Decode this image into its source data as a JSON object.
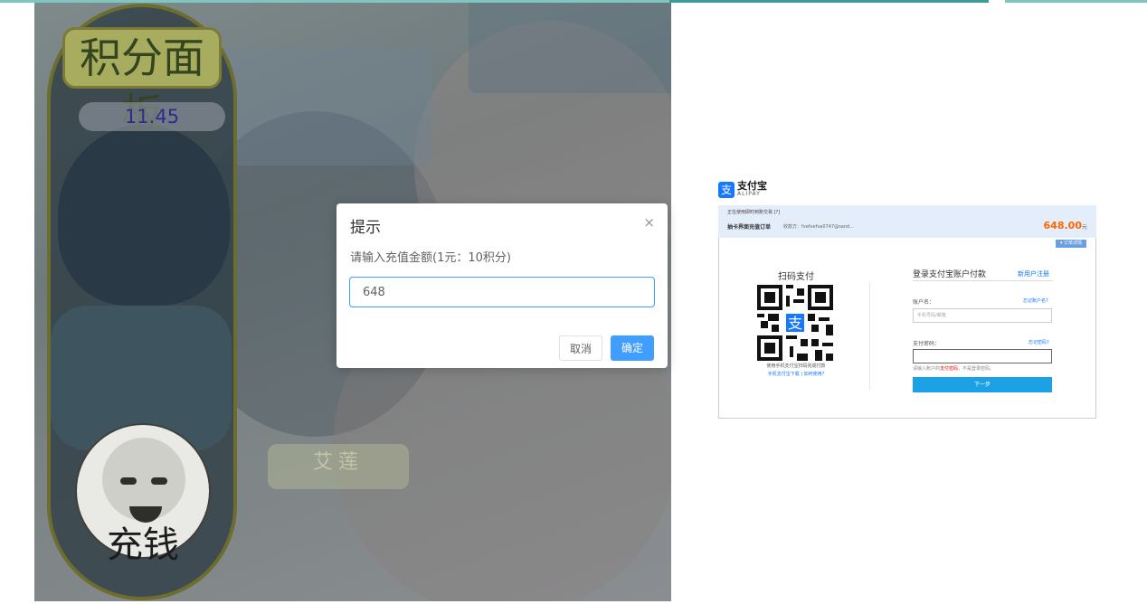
{
  "game": {
    "title": "积分面板",
    "score": "11.45",
    "charge_label": "充钱",
    "ghost_text": "艾莲"
  },
  "dialog": {
    "title": "提示",
    "close": "×",
    "message": "请输入充值金额(1元：10积分)",
    "input_value": "648",
    "cancel_label": "取消",
    "ok_label": "确定"
  },
  "alipay": {
    "logo_glyph": "支",
    "brand": "支付宝",
    "brand_sub": "ALIPAY",
    "order_line1": "正在使用即时到账交易 [?]",
    "order_name": "抽卡界面充值订单",
    "seller": "收款方：fvefvefva0747@sand...",
    "amount": "648.00",
    "amount_unit": "元",
    "detail_btn": "▾ 订单详情",
    "scan_title": "扫码支付",
    "scan_hint": "使用手机支付宝扫码完成付款",
    "scan_links": "手机支付宝下载 | 如何使用?",
    "login_title": "登录支付宝账户付款",
    "register_link": "新用户注册",
    "account_label": "账户名：",
    "forgot_account": "忘记账户名?",
    "account_placeholder": "手机号码/邮箱",
    "password_label": "支付密码：",
    "forgot_password": "忘记密码?",
    "warn_prefix": "请输入账户的",
    "warn_highlight": "支付密码",
    "warn_suffix": "，不是登录密码。",
    "next_label": "下一步"
  },
  "colors": {
    "primary": "#409eff",
    "alipay_blue": "#1677ff",
    "amount_orange": "#ff6600",
    "panel_olive": "#a7ac5e"
  }
}
